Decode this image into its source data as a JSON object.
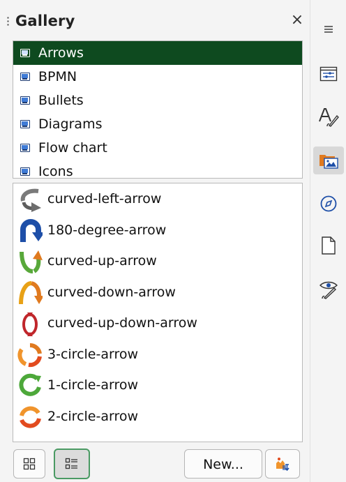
{
  "panel": {
    "title": "Gallery",
    "close_glyph": "×"
  },
  "themes": [
    {
      "label": "Arrows",
      "selected": true
    },
    {
      "label": "BPMN"
    },
    {
      "label": "Bullets"
    },
    {
      "label": "Diagrams"
    },
    {
      "label": "Flow chart"
    },
    {
      "label": "Icons"
    }
  ],
  "items": [
    {
      "label": "curved-left-arrow",
      "icon": "curved-left-arrow-icon"
    },
    {
      "label": "180-degree-arrow",
      "icon": "180-degree-arrow-icon"
    },
    {
      "label": "curved-up-arrow",
      "icon": "curved-up-arrow-icon"
    },
    {
      "label": "curved-down-arrow",
      "icon": "curved-down-arrow-icon"
    },
    {
      "label": "curved-up-down-arrow",
      "icon": "curved-up-down-arrow-icon"
    },
    {
      "label": "3-circle-arrow",
      "icon": "3-circle-arrow-icon"
    },
    {
      "label": "1-circle-arrow",
      "icon": "1-circle-arrow-icon"
    },
    {
      "label": "2-circle-arrow",
      "icon": "2-circle-arrow-icon"
    }
  ],
  "buttons": {
    "new_label": "New...",
    "icon_view": "icon-view-icon",
    "detail_view": "detail-view-icon",
    "theme_properties": "theme-properties-icon"
  },
  "sidebar": [
    "menu-icon",
    "properties-icon",
    "styles-icon",
    "gallery-icon",
    "navigator-icon",
    "page-icon",
    "style-inspector-icon"
  ],
  "colors": {
    "selection": "#0e4a1f",
    "active_border": "#4a9a63",
    "accent_orange": "#e07a1f"
  }
}
